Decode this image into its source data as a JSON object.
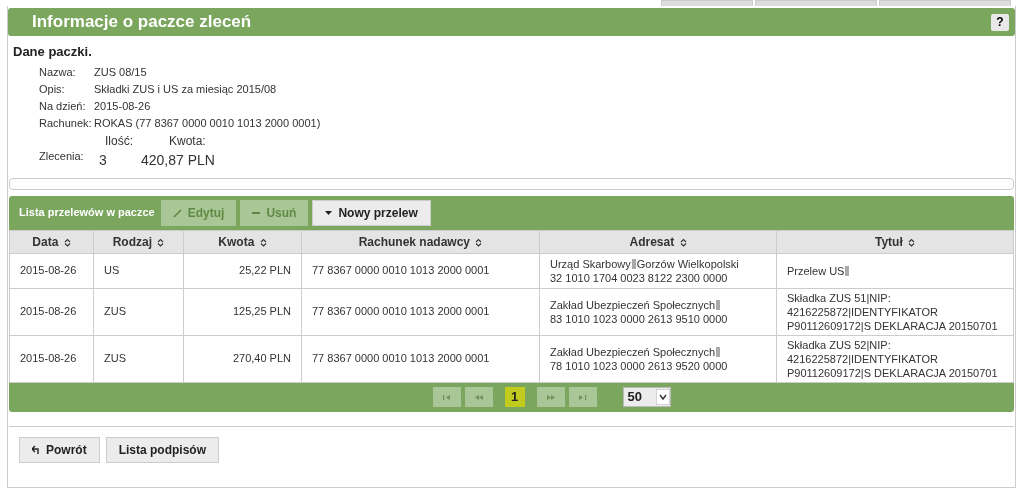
{
  "panel": {
    "title": "Informacje o paczce zleceń",
    "help": "?"
  },
  "details": {
    "heading": "Dane paczki.",
    "fields": [
      {
        "label": "Nazwa:",
        "value": "ZUS 08/15"
      },
      {
        "label": "Opis:",
        "value": "Składki ZUS i US za miesiąc 2015/08"
      },
      {
        "label": "Na dzień:",
        "value": "2015-08-26"
      },
      {
        "label": "Rachunek:",
        "value": "ROKAS (77 8367 0000 0010 1013 2000 0001)"
      }
    ],
    "orders": {
      "label": "Zlecenia:",
      "count_label": "Ilość:",
      "amount_label": "Kwota:",
      "count": "3",
      "amount": "420,87 PLN"
    }
  },
  "list": {
    "title": "Lista przelewów w paczce",
    "toolbar": [
      {
        "label": "Edytuj",
        "kind": "pencil",
        "disabled": true
      },
      {
        "label": "Usuń",
        "kind": "minus",
        "disabled": true
      },
      {
        "label": "Nowy przelew",
        "kind": "caret",
        "disabled": false
      }
    ],
    "columns": [
      {
        "label": "Data"
      },
      {
        "label": "Rodzaj"
      },
      {
        "label": "Kwota"
      },
      {
        "label": "Rachunek nadawcy"
      },
      {
        "label": "Adresat"
      },
      {
        "label": "Tytuł"
      }
    ],
    "rows": [
      {
        "date": "2015-08-26",
        "type": "US",
        "amount": "25,22 PLN",
        "account": "77 8367 0000 0010 1013 2000 0001",
        "recipient": {
          "name_parts": [
            "Urząd Skarbowy",
            "Gorzów Wielkopolski"
          ],
          "trailing_mark": false,
          "account": "32 1010 1704 0023 8122 2300 0000"
        },
        "title": {
          "lines": [
            "Przelew US"
          ],
          "trailing_mark": true
        }
      },
      {
        "date": "2015-08-26",
        "type": "ZUS",
        "amount": "125,25 PLN",
        "account": "77 8367 0000 0010 1013 2000 0001",
        "recipient": {
          "name_parts": [
            "Zakład Ubezpieczeń Społecznych"
          ],
          "trailing_mark": true,
          "account": "83 1010 1023 0000 2613 9510 0000"
        },
        "title": {
          "lines": [
            "Składka ZUS 51|NIP:",
            "4216225872|IDENTYFIKATOR",
            "P90112609172|S DEKLARACJA 20150701"
          ],
          "trailing_mark": false
        }
      },
      {
        "date": "2015-08-26",
        "type": "ZUS",
        "amount": "270,40 PLN",
        "account": "77 8367 0000 0010 1013 2000 0001",
        "recipient": {
          "name_parts": [
            "Zakład Ubezpieczeń Społecznych"
          ],
          "trailing_mark": true,
          "account": "78 1010 1023 0000 2613 9520 0000"
        },
        "title": {
          "lines": [
            "Składka ZUS 52|NIP:",
            "4216225872|IDENTYFIKATOR",
            "P90112609172|S DEKLARACJA 20150701"
          ],
          "trailing_mark": false
        }
      }
    ],
    "pager": {
      "nav": [
        {
          "kind": "first",
          "disabled": true
        },
        {
          "kind": "prev",
          "disabled": true
        }
      ],
      "pages": [
        {
          "label": "1",
          "selected": true
        }
      ],
      "nav_after": [
        {
          "kind": "next",
          "disabled": true
        },
        {
          "kind": "last",
          "disabled": true
        }
      ],
      "page_size": "50"
    }
  },
  "actions": [
    {
      "label": "Powrót",
      "kind": "back"
    },
    {
      "label": "Lista podpisów",
      "kind": "plain"
    }
  ]
}
